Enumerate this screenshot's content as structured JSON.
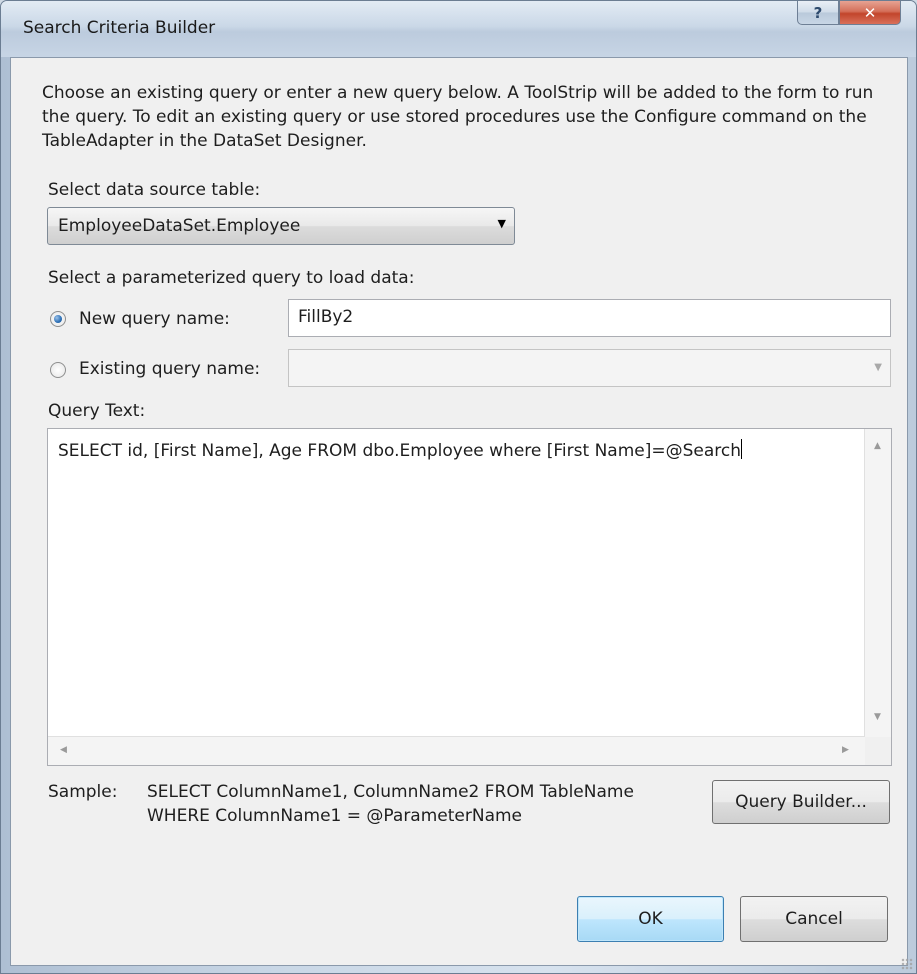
{
  "window": {
    "title": "Search Criteria Builder",
    "help_label": "?",
    "close_label": "✕"
  },
  "description": "Choose an existing query or enter a new query below. A ToolStrip will be added to the form to run the query. To edit an existing query or use stored procedures use the Configure command on the TableAdapter in the DataSet Designer.",
  "data_source": {
    "label": "Select data source table:",
    "selected": "EmployeeDataSet.Employee"
  },
  "query_select": {
    "label": "Select a parameterized query to load data:",
    "new_query": {
      "label": "New query name:",
      "value": "FillBy2",
      "checked": true
    },
    "existing_query": {
      "label": "Existing query name:",
      "value": "",
      "checked": false
    }
  },
  "query_text": {
    "label": "Query Text:",
    "value": "SELECT id, [First Name], Age FROM dbo.Employee where [First Name]=@Search"
  },
  "sample": {
    "label": "Sample:",
    "line1": "SELECT ColumnName1, ColumnName2 FROM TableName",
    "line2": "WHERE ColumnName1 = @ParameterName"
  },
  "buttons": {
    "query_builder": "Query Builder...",
    "ok": "OK",
    "cancel": "Cancel"
  }
}
